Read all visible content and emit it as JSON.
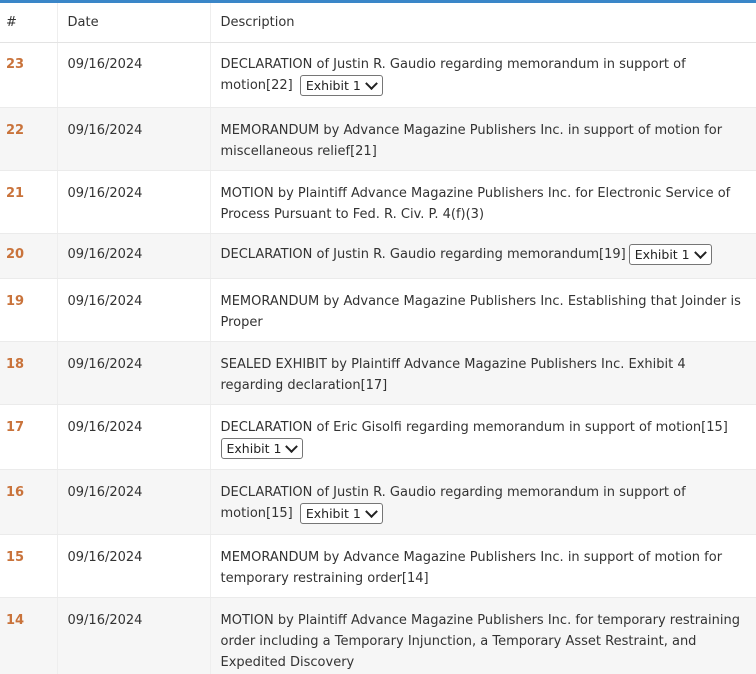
{
  "table": {
    "headers": {
      "num": "#",
      "date": "Date",
      "description": "Description"
    },
    "rows": [
      {
        "num": "23",
        "date": "09/16/2024",
        "description": "DECLARATION of Justin R. Gaudio regarding memorandum in support of motion[22]",
        "exhibit": "Exhibit 1"
      },
      {
        "num": "22",
        "date": "09/16/2024",
        "description": "MEMORANDUM by Advance Magazine Publishers Inc. in support of motion for miscellaneous relief[21]"
      },
      {
        "num": "21",
        "date": "09/16/2024",
        "description": "MOTION by Plaintiff Advance Magazine Publishers Inc. for Electronic Service of Process Pursuant to Fed. R. Civ. P. 4(f)(3)"
      },
      {
        "num": "20",
        "date": "09/16/2024",
        "description": "DECLARATION of Justin R. Gaudio regarding memorandum[19]",
        "exhibit": "Exhibit 1"
      },
      {
        "num": "19",
        "date": "09/16/2024",
        "description": "MEMORANDUM by Advance Magazine Publishers Inc. Establishing that Joinder is Proper"
      },
      {
        "num": "18",
        "date": "09/16/2024",
        "description": "SEALED EXHIBIT by Plaintiff Advance Magazine Publishers Inc. Exhibit 4 regarding declaration[17]"
      },
      {
        "num": "17",
        "date": "09/16/2024",
        "description": "DECLARATION of Eric Gisolfi regarding memorandum in support of motion[15]",
        "exhibit": "Exhibit 1"
      },
      {
        "num": "16",
        "date": "09/16/2024",
        "description": "DECLARATION of Justin R. Gaudio regarding memorandum in support of motion[15]",
        "exhibit": "Exhibit 1"
      },
      {
        "num": "15",
        "date": "09/16/2024",
        "description": "MEMORANDUM by Advance Magazine Publishers Inc. in support of motion for temporary restraining order[14]"
      },
      {
        "num": "14",
        "date": "09/16/2024",
        "description": "MOTION by Plaintiff Advance Magazine Publishers Inc. for temporary restraining order including a Temporary Injunction, a Temporary Asset Restraint, and Expedited Discovery"
      }
    ]
  },
  "colors": {
    "accent_top_border": "#3a86c8",
    "entry_number": "#c9733b",
    "stripe": "#f6f6f6"
  }
}
